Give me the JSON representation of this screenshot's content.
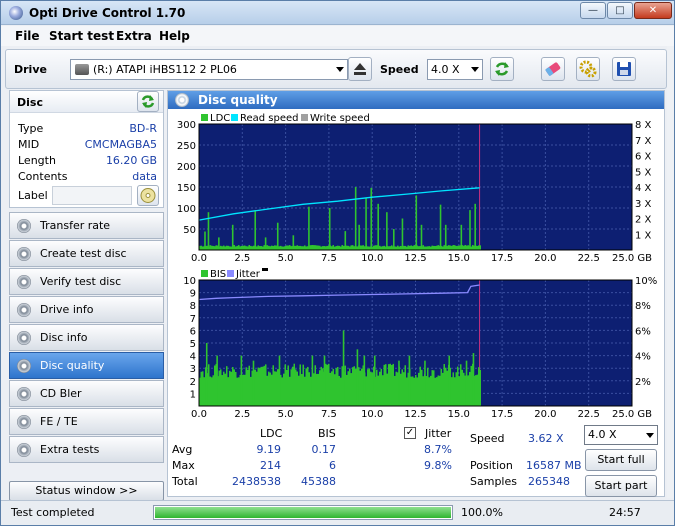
{
  "window": {
    "title": "Opti Drive Control 1.70",
    "min": "—",
    "max": "□",
    "close": "✕"
  },
  "menu": [
    "File",
    "Start test",
    "Extra",
    "Help"
  ],
  "toolbar": {
    "drive_label": "Drive",
    "drive_value": "(R:)  ATAPI iHBS112  2 PL06",
    "speed_label": "Speed",
    "speed_value": "4.0 X"
  },
  "disc": {
    "title": "Disc",
    "rows": [
      {
        "k": "Type",
        "v": "BD-R"
      },
      {
        "k": "MID",
        "v": "CMCMAGBA5"
      },
      {
        "k": "Length",
        "v": "16.20 GB"
      },
      {
        "k": "Contents",
        "v": "data"
      }
    ],
    "label_label": "Label",
    "label_value": ""
  },
  "nav": [
    {
      "label": "Transfer rate",
      "active": false
    },
    {
      "label": "Create test disc",
      "active": false
    },
    {
      "label": "Verify test disc",
      "active": false
    },
    {
      "label": "Drive info",
      "active": false
    },
    {
      "label": "Disc info",
      "active": false
    },
    {
      "label": "Disc quality",
      "active": true
    },
    {
      "label": "CD Bler",
      "active": false
    },
    {
      "label": "FE / TE",
      "active": false
    },
    {
      "label": "Extra tests",
      "active": false
    }
  ],
  "status_window_label": "Status window >>",
  "main": {
    "title": "Disc quality"
  },
  "colors": {
    "plot_bg": "#0d1f72",
    "ldc": "#2fc42f",
    "read_speed": "#00e5ff",
    "write_speed": "#a0a0a0",
    "bis": "#2fc42f",
    "jitter": "#8a8aff",
    "grid": "#3a4fa0",
    "marker": "#cc2f7f"
  },
  "chart_data": [
    {
      "type": "bar",
      "legend": [
        "LDC",
        "Read speed",
        "Write speed"
      ],
      "x_ticks": [
        "0.0",
        "2.5",
        "5.0",
        "7.5",
        "10.0",
        "12.5",
        "15.0",
        "17.5",
        "20.0",
        "22.5",
        "25.0 GB"
      ],
      "xlim": [
        0,
        25
      ],
      "y_ticks": [
        "50",
        "100",
        "150",
        "200",
        "250",
        "300"
      ],
      "ylim": [
        0,
        300
      ],
      "y2_ticks": [
        "1 X",
        "2 X",
        "3 X",
        "4 X",
        "5 X",
        "6 X",
        "7 X",
        "8 X"
      ],
      "y2lim": [
        0,
        8
      ],
      "disc_end_gb": 16.2,
      "ldc_typical": 10,
      "ldc_spikes": [
        [
          0.3,
          44
        ],
        [
          0.5,
          90
        ],
        [
          1.1,
          30
        ],
        [
          1.9,
          60
        ],
        [
          3.2,
          95
        ],
        [
          3.8,
          30
        ],
        [
          4.5,
          65
        ],
        [
          5.4,
          35
        ],
        [
          6.3,
          103
        ],
        [
          7.5,
          100
        ],
        [
          8.4,
          45
        ],
        [
          9.0,
          150
        ],
        [
          9.2,
          60
        ],
        [
          9.6,
          125
        ],
        [
          9.9,
          148
        ],
        [
          10.3,
          110
        ],
        [
          10.8,
          90
        ],
        [
          11.2,
          50
        ],
        [
          11.7,
          75
        ],
        [
          12.5,
          130
        ],
        [
          12.8,
          60
        ],
        [
          13.9,
          108
        ],
        [
          14.2,
          60
        ],
        [
          15.1,
          60
        ],
        [
          15.6,
          95
        ],
        [
          15.9,
          110
        ]
      ],
      "read_speed": {
        "x": [
          0,
          2,
          4,
          6,
          8,
          10,
          12,
          14,
          16.2
        ],
        "y": [
          1.9,
          2.3,
          2.6,
          2.9,
          3.1,
          3.35,
          3.55,
          3.75,
          3.95
        ]
      }
    },
    {
      "type": "bar",
      "legend": [
        "BIS",
        "Jitter"
      ],
      "x_ticks": [
        "0.0",
        "2.5",
        "5.0",
        "7.5",
        "10.0",
        "12.5",
        "15.0",
        "17.5",
        "20.0",
        "22.5",
        "25.0 GB"
      ],
      "xlim": [
        0,
        25
      ],
      "y_ticks": [
        "1",
        "2",
        "3",
        "4",
        "5",
        "6",
        "7",
        "8",
        "9",
        "10"
      ],
      "ylim": [
        0,
        10
      ],
      "y2_ticks": [
        "2%",
        "4%",
        "6%",
        "8%",
        "10%"
      ],
      "y2lim": [
        0,
        10
      ],
      "disc_end_gb": 16.2,
      "bis_typical": 2.8,
      "bis_spikes": [
        [
          0.4,
          5
        ],
        [
          1.0,
          4
        ],
        [
          2.4,
          4
        ],
        [
          3.1,
          3.6
        ],
        [
          4.6,
          4
        ],
        [
          6.5,
          4
        ],
        [
          7.2,
          4
        ],
        [
          8.3,
          6
        ],
        [
          9.1,
          4.5
        ],
        [
          9.5,
          4
        ],
        [
          10.1,
          4
        ],
        [
          11.5,
          3.6
        ],
        [
          12.1,
          4
        ],
        [
          13.0,
          3.6
        ],
        [
          14.4,
          4
        ],
        [
          15.4,
          3.6
        ],
        [
          15.8,
          4.2
        ]
      ],
      "jitter": {
        "x": [
          0,
          1,
          2,
          4,
          6,
          8,
          10,
          12,
          14,
          15.5,
          15.7,
          16.2
        ],
        "y": [
          8.45,
          8.55,
          8.6,
          8.7,
          8.75,
          8.8,
          8.85,
          8.9,
          8.95,
          9.0,
          9.5,
          9.6
        ]
      }
    }
  ],
  "stats": {
    "hdr_ldc": "LDC",
    "hdr_bis": "BIS",
    "hdr_jitter": "Jitter",
    "rows": [
      {
        "k": "Avg",
        "ldc": "9.19",
        "bis": "0.17",
        "jit": "8.7%"
      },
      {
        "k": "Max",
        "ldc": "214",
        "bis": "6",
        "jit": "9.8%"
      },
      {
        "k": "Total",
        "ldc": "2438538",
        "bis": "45388",
        "jit": ""
      }
    ],
    "speed_label": "Speed",
    "speed_value": "3.62 X",
    "position_label": "Position",
    "position_value": "16587 MB",
    "samples_label": "Samples",
    "samples_value": "265348",
    "speed_select": "4.0 X",
    "start_full": "Start full",
    "start_part": "Start part"
  },
  "statusbar": {
    "text": "Test completed",
    "progress_pct": "100.0%",
    "progress": 1.0,
    "time": "24:57"
  }
}
